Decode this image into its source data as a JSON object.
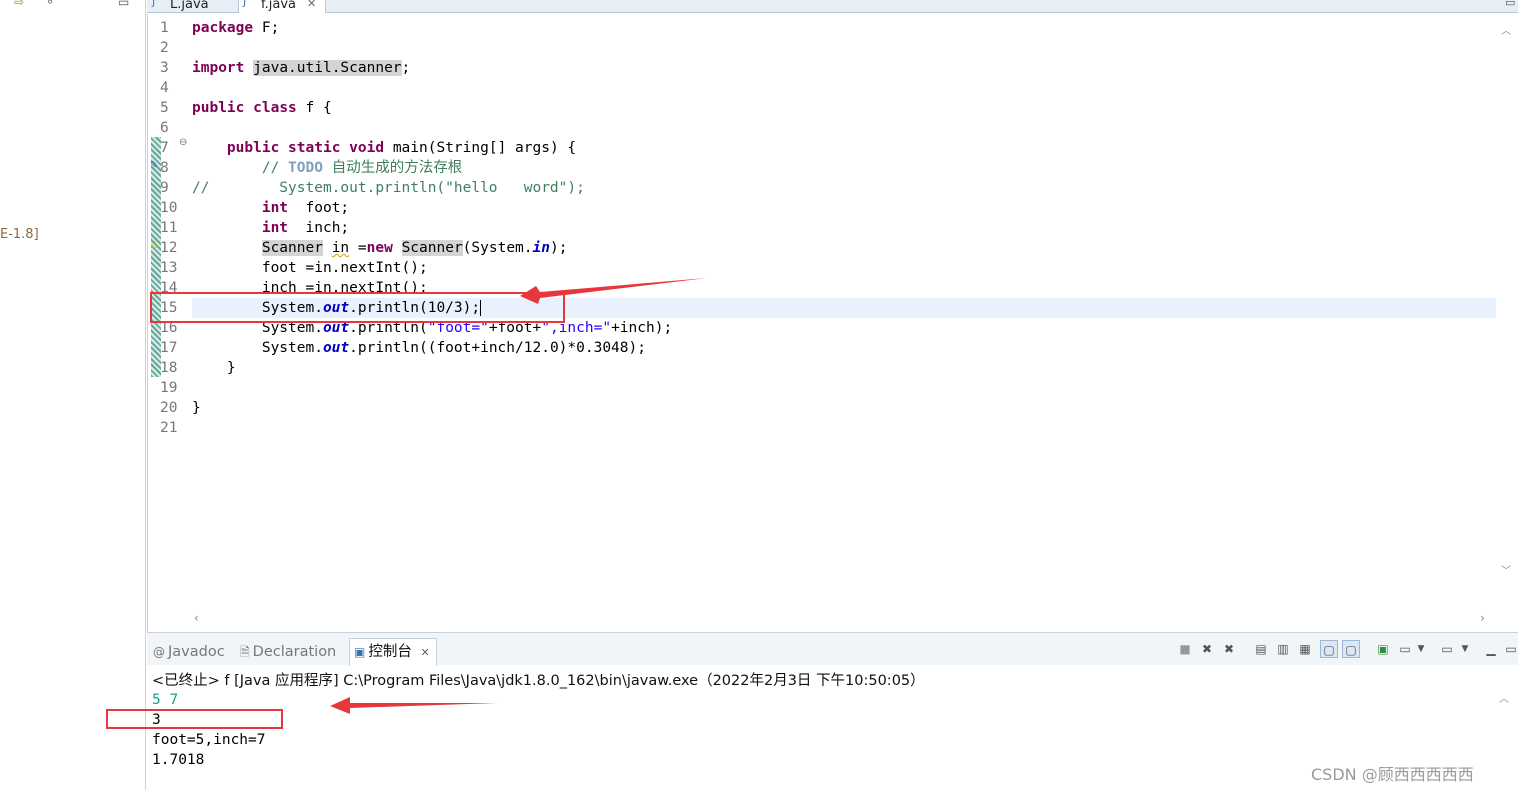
{
  "left_panel": {
    "tree_label_fragment": "E-1.8]"
  },
  "editor": {
    "tabs": [
      {
        "label": "L.java",
        "active": false
      },
      {
        "label": "f.java",
        "active": true
      }
    ],
    "line_numbers": [
      "1",
      "2",
      "3",
      "4",
      "5",
      "6",
      "7",
      "8",
      "9",
      "10",
      "11",
      "12",
      "13",
      "14",
      "15",
      "16",
      "17",
      "18",
      "19",
      "20",
      "21"
    ],
    "current_line": 15
  },
  "console": {
    "tabs": [
      {
        "label": "Javadoc",
        "icon": "at-icon"
      },
      {
        "label": "Declaration",
        "icon": "declaration-icon"
      },
      {
        "label": "控制台",
        "icon": "console-icon",
        "active": true
      }
    ],
    "header": "<已终止> f [Java 应用程序] C:\\Program Files\\Java\\jdk1.8.0_162\\bin\\javaw.exe（2022年2月3日 下午10:50:05）",
    "output_lines": [
      {
        "text": "5 7",
        "kind": "input"
      },
      {
        "text": "3",
        "kind": "output"
      },
      {
        "text": "foot=5,inch=7",
        "kind": "output"
      },
      {
        "text": "1.7018",
        "kind": "output"
      }
    ]
  },
  "watermark": "CSDN @顾西西西西西",
  "colors": {
    "keyword": "#7f0055",
    "comment": "#3f7f5f",
    "string": "#2a00ff",
    "static_field": "#0000c0",
    "current_line": "#e8f2fe",
    "annotation_red": "#e8373c",
    "console_input": "#1ea08a"
  }
}
